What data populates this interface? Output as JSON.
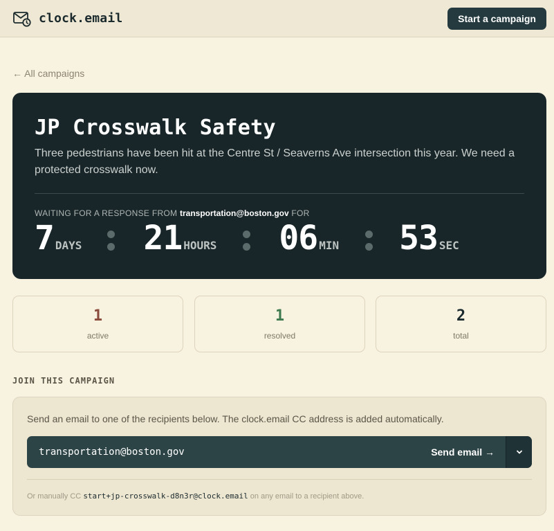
{
  "header": {
    "brand_name": "clock.email",
    "start_button": "Start a campaign"
  },
  "back_link": "← All campaigns",
  "campaign": {
    "title": "JP Crosswalk Safety",
    "description": "Three pedestrians have been hit at the Centre St / Seaverns Ave intersection this year. We need a protected crosswalk now.",
    "waiting_prefix": "WAITING FOR A RESPONSE FROM",
    "waiting_email": "transportation@boston.gov",
    "waiting_suffix": "FOR",
    "countdown": {
      "days": "7",
      "days_label": "DAYS",
      "hours": "21",
      "hours_label": "HOURS",
      "minutes": "06",
      "minutes_label": "MIN",
      "seconds": "53",
      "seconds_label": "SEC"
    }
  },
  "stats": [
    {
      "value": "1",
      "label": "active",
      "color": "#8a4a3c"
    },
    {
      "value": "1",
      "label": "resolved",
      "color": "#3f7a4f"
    },
    {
      "value": "2",
      "label": "total",
      "color": "#1b2a2d"
    }
  ],
  "join": {
    "heading": "JOIN THIS CAMPAIGN",
    "instructions": "Send an email to one of the recipients below. The clock.email CC address is added automatically.",
    "recipient": "transportation@boston.gov",
    "send_label": "Send email →",
    "manual_prefix": "Or manually CC",
    "cc_address": "start+jp-crosswalk-d8n3r@clock.email",
    "manual_suffix": "on any email to a recipient above."
  },
  "colors": {
    "background": "#f8f2e0",
    "hero": "#192629",
    "accent_button": "#243a3f"
  }
}
